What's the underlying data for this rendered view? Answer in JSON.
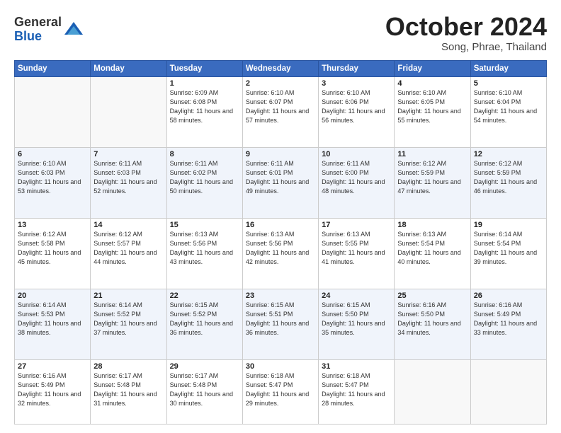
{
  "header": {
    "logo_general": "General",
    "logo_blue": "Blue",
    "month": "October 2024",
    "location": "Song, Phrae, Thailand"
  },
  "days_of_week": [
    "Sunday",
    "Monday",
    "Tuesday",
    "Wednesday",
    "Thursday",
    "Friday",
    "Saturday"
  ],
  "weeks": [
    [
      {
        "day": "",
        "sunrise": "",
        "sunset": "",
        "daylight": ""
      },
      {
        "day": "",
        "sunrise": "",
        "sunset": "",
        "daylight": ""
      },
      {
        "day": "1",
        "sunrise": "Sunrise: 6:09 AM",
        "sunset": "Sunset: 6:08 PM",
        "daylight": "Daylight: 11 hours and 58 minutes."
      },
      {
        "day": "2",
        "sunrise": "Sunrise: 6:10 AM",
        "sunset": "Sunset: 6:07 PM",
        "daylight": "Daylight: 11 hours and 57 minutes."
      },
      {
        "day": "3",
        "sunrise": "Sunrise: 6:10 AM",
        "sunset": "Sunset: 6:06 PM",
        "daylight": "Daylight: 11 hours and 56 minutes."
      },
      {
        "day": "4",
        "sunrise": "Sunrise: 6:10 AM",
        "sunset": "Sunset: 6:05 PM",
        "daylight": "Daylight: 11 hours and 55 minutes."
      },
      {
        "day": "5",
        "sunrise": "Sunrise: 6:10 AM",
        "sunset": "Sunset: 6:04 PM",
        "daylight": "Daylight: 11 hours and 54 minutes."
      }
    ],
    [
      {
        "day": "6",
        "sunrise": "Sunrise: 6:10 AM",
        "sunset": "Sunset: 6:03 PM",
        "daylight": "Daylight: 11 hours and 53 minutes."
      },
      {
        "day": "7",
        "sunrise": "Sunrise: 6:11 AM",
        "sunset": "Sunset: 6:03 PM",
        "daylight": "Daylight: 11 hours and 52 minutes."
      },
      {
        "day": "8",
        "sunrise": "Sunrise: 6:11 AM",
        "sunset": "Sunset: 6:02 PM",
        "daylight": "Daylight: 11 hours and 50 minutes."
      },
      {
        "day": "9",
        "sunrise": "Sunrise: 6:11 AM",
        "sunset": "Sunset: 6:01 PM",
        "daylight": "Daylight: 11 hours and 49 minutes."
      },
      {
        "day": "10",
        "sunrise": "Sunrise: 6:11 AM",
        "sunset": "Sunset: 6:00 PM",
        "daylight": "Daylight: 11 hours and 48 minutes."
      },
      {
        "day": "11",
        "sunrise": "Sunrise: 6:12 AM",
        "sunset": "Sunset: 5:59 PM",
        "daylight": "Daylight: 11 hours and 47 minutes."
      },
      {
        "day": "12",
        "sunrise": "Sunrise: 6:12 AM",
        "sunset": "Sunset: 5:59 PM",
        "daylight": "Daylight: 11 hours and 46 minutes."
      }
    ],
    [
      {
        "day": "13",
        "sunrise": "Sunrise: 6:12 AM",
        "sunset": "Sunset: 5:58 PM",
        "daylight": "Daylight: 11 hours and 45 minutes."
      },
      {
        "day": "14",
        "sunrise": "Sunrise: 6:12 AM",
        "sunset": "Sunset: 5:57 PM",
        "daylight": "Daylight: 11 hours and 44 minutes."
      },
      {
        "day": "15",
        "sunrise": "Sunrise: 6:13 AM",
        "sunset": "Sunset: 5:56 PM",
        "daylight": "Daylight: 11 hours and 43 minutes."
      },
      {
        "day": "16",
        "sunrise": "Sunrise: 6:13 AM",
        "sunset": "Sunset: 5:56 PM",
        "daylight": "Daylight: 11 hours and 42 minutes."
      },
      {
        "day": "17",
        "sunrise": "Sunrise: 6:13 AM",
        "sunset": "Sunset: 5:55 PM",
        "daylight": "Daylight: 11 hours and 41 minutes."
      },
      {
        "day": "18",
        "sunrise": "Sunrise: 6:13 AM",
        "sunset": "Sunset: 5:54 PM",
        "daylight": "Daylight: 11 hours and 40 minutes."
      },
      {
        "day": "19",
        "sunrise": "Sunrise: 6:14 AM",
        "sunset": "Sunset: 5:54 PM",
        "daylight": "Daylight: 11 hours and 39 minutes."
      }
    ],
    [
      {
        "day": "20",
        "sunrise": "Sunrise: 6:14 AM",
        "sunset": "Sunset: 5:53 PM",
        "daylight": "Daylight: 11 hours and 38 minutes."
      },
      {
        "day": "21",
        "sunrise": "Sunrise: 6:14 AM",
        "sunset": "Sunset: 5:52 PM",
        "daylight": "Daylight: 11 hours and 37 minutes."
      },
      {
        "day": "22",
        "sunrise": "Sunrise: 6:15 AM",
        "sunset": "Sunset: 5:52 PM",
        "daylight": "Daylight: 11 hours and 36 minutes."
      },
      {
        "day": "23",
        "sunrise": "Sunrise: 6:15 AM",
        "sunset": "Sunset: 5:51 PM",
        "daylight": "Daylight: 11 hours and 36 minutes."
      },
      {
        "day": "24",
        "sunrise": "Sunrise: 6:15 AM",
        "sunset": "Sunset: 5:50 PM",
        "daylight": "Daylight: 11 hours and 35 minutes."
      },
      {
        "day": "25",
        "sunrise": "Sunrise: 6:16 AM",
        "sunset": "Sunset: 5:50 PM",
        "daylight": "Daylight: 11 hours and 34 minutes."
      },
      {
        "day": "26",
        "sunrise": "Sunrise: 6:16 AM",
        "sunset": "Sunset: 5:49 PM",
        "daylight": "Daylight: 11 hours and 33 minutes."
      }
    ],
    [
      {
        "day": "27",
        "sunrise": "Sunrise: 6:16 AM",
        "sunset": "Sunset: 5:49 PM",
        "daylight": "Daylight: 11 hours and 32 minutes."
      },
      {
        "day": "28",
        "sunrise": "Sunrise: 6:17 AM",
        "sunset": "Sunset: 5:48 PM",
        "daylight": "Daylight: 11 hours and 31 minutes."
      },
      {
        "day": "29",
        "sunrise": "Sunrise: 6:17 AM",
        "sunset": "Sunset: 5:48 PM",
        "daylight": "Daylight: 11 hours and 30 minutes."
      },
      {
        "day": "30",
        "sunrise": "Sunrise: 6:18 AM",
        "sunset": "Sunset: 5:47 PM",
        "daylight": "Daylight: 11 hours and 29 minutes."
      },
      {
        "day": "31",
        "sunrise": "Sunrise: 6:18 AM",
        "sunset": "Sunset: 5:47 PM",
        "daylight": "Daylight: 11 hours and 28 minutes."
      },
      {
        "day": "",
        "sunrise": "",
        "sunset": "",
        "daylight": ""
      },
      {
        "day": "",
        "sunrise": "",
        "sunset": "",
        "daylight": ""
      }
    ]
  ]
}
